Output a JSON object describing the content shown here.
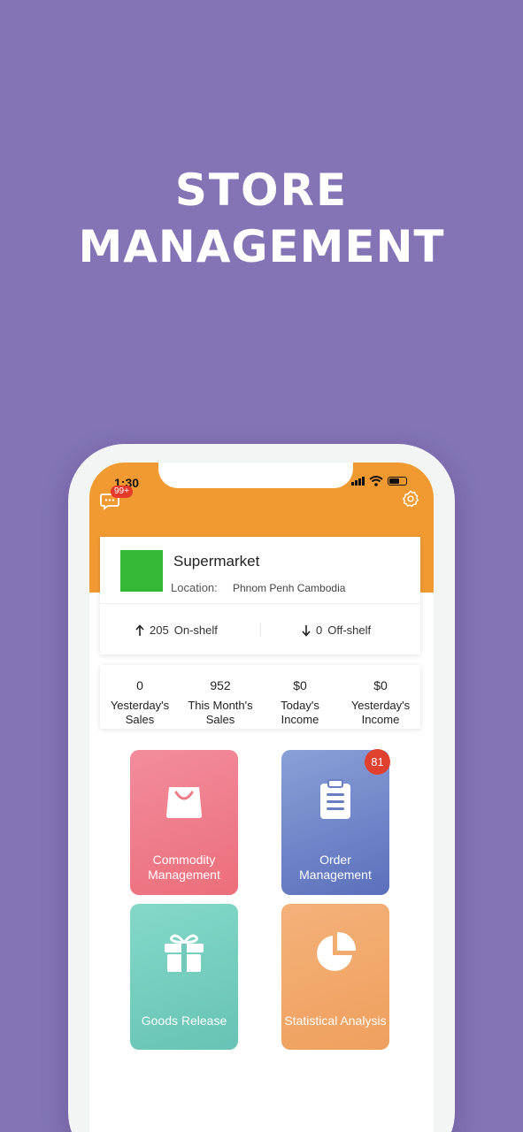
{
  "promo": {
    "line1": "STORE",
    "line2": "MANAGEMENT"
  },
  "colors": {
    "background": "#8474b6",
    "header": "#f29a32",
    "store_logo": "#36b837"
  },
  "status_bar": {
    "time": "1:30"
  },
  "header": {
    "message_badge": "99+",
    "message_icon": "message-icon",
    "settings_icon": "gear-icon"
  },
  "store": {
    "name": "Supermarket",
    "location_label": "Location:",
    "location": "Phnom Penh Cambodia",
    "on_shelf_count": "205",
    "on_shelf_label": "On-shelf",
    "off_shelf_count": "0",
    "off_shelf_label": "Off-shelf"
  },
  "stats": [
    {
      "value": "0",
      "label_line1": "Yesterday's",
      "label_line2": "Sales"
    },
    {
      "value": "952",
      "label_line1": "This Month's",
      "label_line2": "Sales"
    },
    {
      "value": "$0",
      "label_line1": "Today's",
      "label_line2": "Income"
    },
    {
      "value": "$0",
      "label_line1": "Yesterday's",
      "label_line2": "Income"
    }
  ],
  "tiles": [
    {
      "line1": "Commodity",
      "line2": "Management",
      "icon": "shopping-bag-icon"
    },
    {
      "line1": "Order",
      "line2": "Management",
      "badge": "81",
      "icon": "clipboard-icon"
    },
    {
      "label": "Goods Release",
      "icon": "gift-icon"
    },
    {
      "label": "Statistical Analysis",
      "icon": "pie-chart-icon"
    }
  ]
}
